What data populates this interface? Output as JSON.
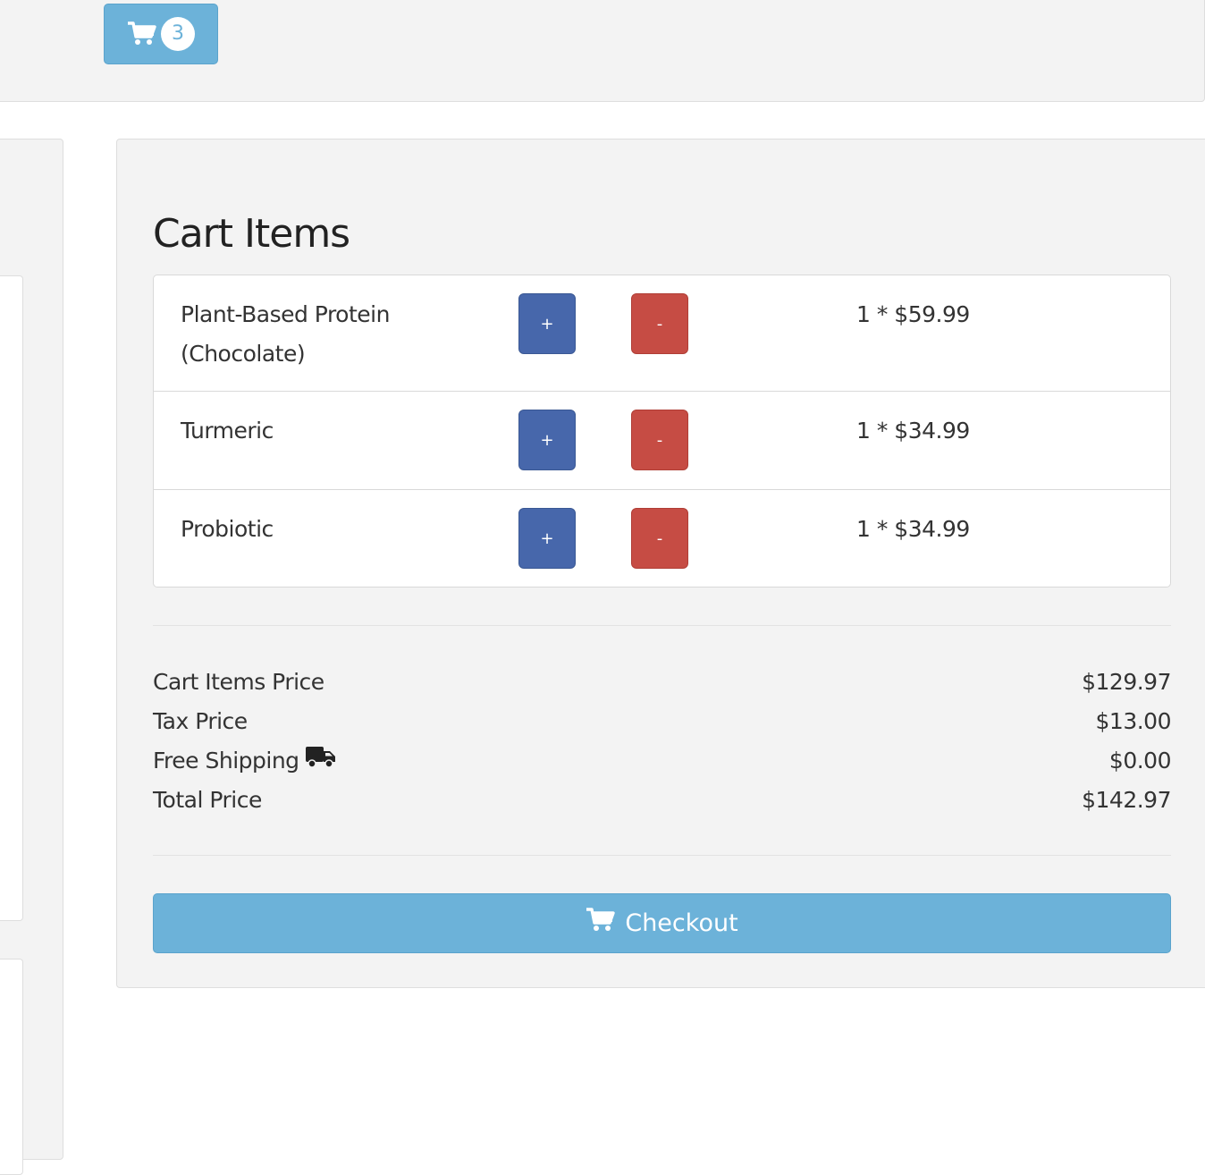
{
  "header": {
    "cart_count": "3",
    "cart_icon": "cart-icon"
  },
  "cart": {
    "title": "Cart Items",
    "items": [
      {
        "name": "Plant-Based Protein (Chocolate)",
        "plus_label": "+",
        "minus_label": "-",
        "price_text": "1 * $59.99"
      },
      {
        "name": "Turmeric",
        "plus_label": "+",
        "minus_label": "-",
        "price_text": "1 * $34.99"
      },
      {
        "name": "Probiotic",
        "plus_label": "+",
        "minus_label": "-",
        "price_text": "1 * $34.99"
      }
    ]
  },
  "summary": {
    "items_price_label": "Cart Items Price",
    "items_price_value": "$129.97",
    "tax_label": "Tax Price",
    "tax_value": "$13.00",
    "shipping_label": "Free Shipping",
    "shipping_icon": "truck-icon",
    "shipping_value": "$0.00",
    "total_label": "Total Price",
    "total_value": "$142.97"
  },
  "checkout": {
    "label": "Checkout",
    "icon": "cart-icon"
  },
  "colors": {
    "accent": "#6cb2d9",
    "plus": "#4767ab",
    "minus": "#c64c44",
    "panel_bg": "#f3f3f3"
  }
}
